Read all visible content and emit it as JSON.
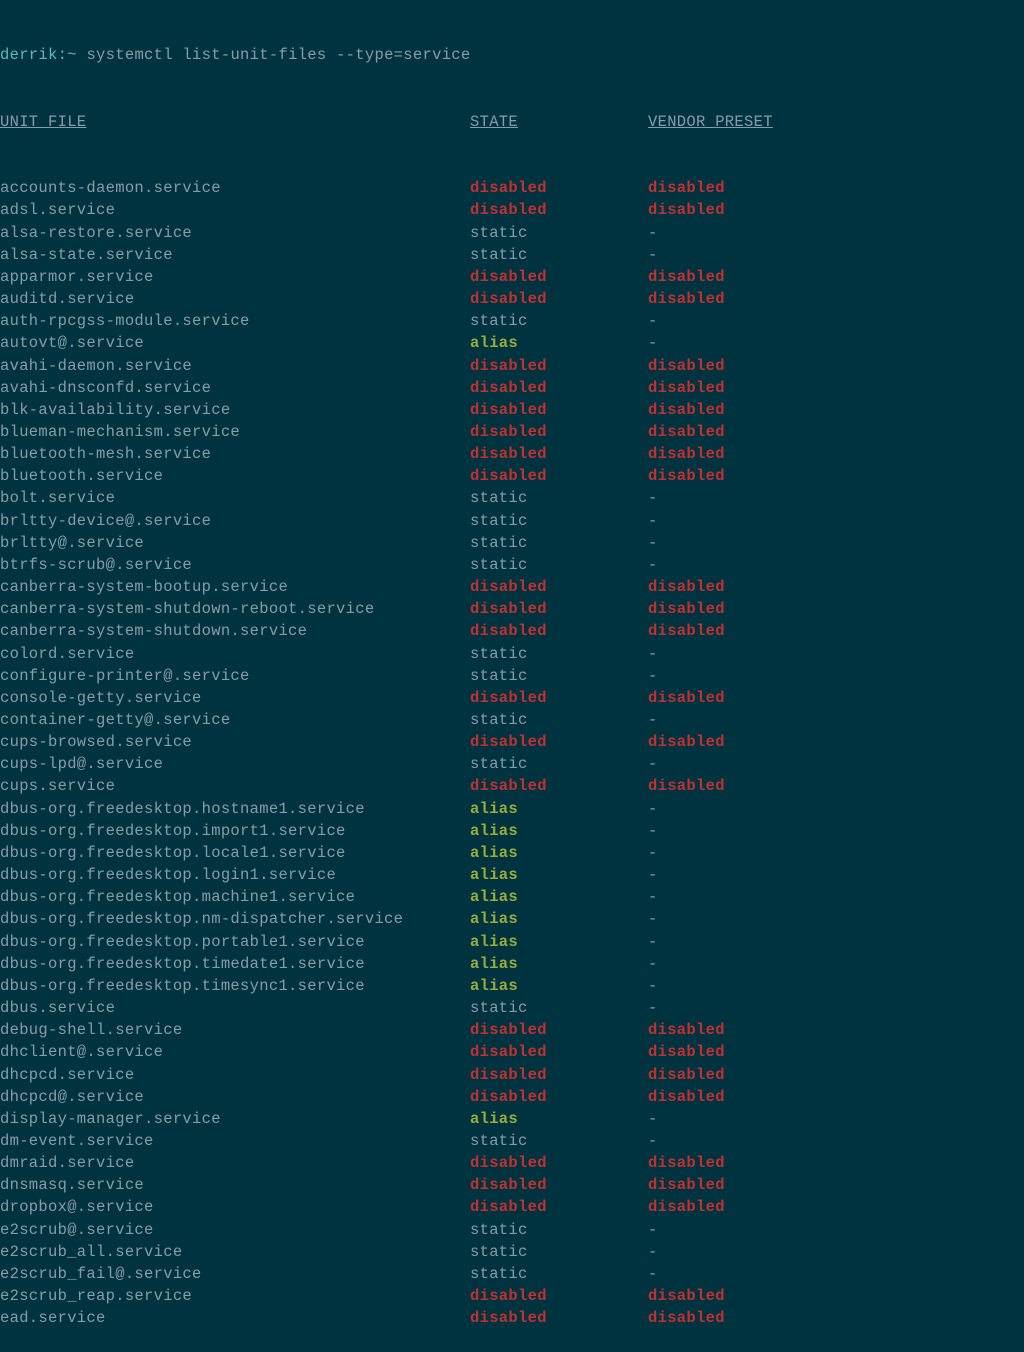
{
  "prompt": {
    "user": "derrik",
    "separator": ":",
    "path": "~",
    "command": "systemctl list-unit-files --type=service"
  },
  "headers": {
    "unit": "UNIT FILE",
    "state": "STATE",
    "preset": "VENDOR PRESET"
  },
  "rows": [
    {
      "unit": "accounts-daemon.service",
      "state": "disabled",
      "preset": "disabled"
    },
    {
      "unit": "adsl.service",
      "state": "disabled",
      "preset": "disabled"
    },
    {
      "unit": "alsa-restore.service",
      "state": "static",
      "preset": "-"
    },
    {
      "unit": "alsa-state.service",
      "state": "static",
      "preset": "-"
    },
    {
      "unit": "apparmor.service",
      "state": "disabled",
      "preset": "disabled"
    },
    {
      "unit": "auditd.service",
      "state": "disabled",
      "preset": "disabled"
    },
    {
      "unit": "auth-rpcgss-module.service",
      "state": "static",
      "preset": "-"
    },
    {
      "unit": "autovt@.service",
      "state": "alias",
      "preset": "-"
    },
    {
      "unit": "avahi-daemon.service",
      "state": "disabled",
      "preset": "disabled"
    },
    {
      "unit": "avahi-dnsconfd.service",
      "state": "disabled",
      "preset": "disabled"
    },
    {
      "unit": "blk-availability.service",
      "state": "disabled",
      "preset": "disabled"
    },
    {
      "unit": "blueman-mechanism.service",
      "state": "disabled",
      "preset": "disabled"
    },
    {
      "unit": "bluetooth-mesh.service",
      "state": "disabled",
      "preset": "disabled"
    },
    {
      "unit": "bluetooth.service",
      "state": "disabled",
      "preset": "disabled"
    },
    {
      "unit": "bolt.service",
      "state": "static",
      "preset": "-"
    },
    {
      "unit": "brltty-device@.service",
      "state": "static",
      "preset": "-"
    },
    {
      "unit": "brltty@.service",
      "state": "static",
      "preset": "-"
    },
    {
      "unit": "btrfs-scrub@.service",
      "state": "static",
      "preset": "-"
    },
    {
      "unit": "canberra-system-bootup.service",
      "state": "disabled",
      "preset": "disabled"
    },
    {
      "unit": "canberra-system-shutdown-reboot.service",
      "state": "disabled",
      "preset": "disabled"
    },
    {
      "unit": "canberra-system-shutdown.service",
      "state": "disabled",
      "preset": "disabled"
    },
    {
      "unit": "colord.service",
      "state": "static",
      "preset": "-"
    },
    {
      "unit": "configure-printer@.service",
      "state": "static",
      "preset": "-"
    },
    {
      "unit": "console-getty.service",
      "state": "disabled",
      "preset": "disabled"
    },
    {
      "unit": "container-getty@.service",
      "state": "static",
      "preset": "-"
    },
    {
      "unit": "cups-browsed.service",
      "state": "disabled",
      "preset": "disabled"
    },
    {
      "unit": "cups-lpd@.service",
      "state": "static",
      "preset": "-"
    },
    {
      "unit": "cups.service",
      "state": "disabled",
      "preset": "disabled"
    },
    {
      "unit": "dbus-org.freedesktop.hostname1.service",
      "state": "alias",
      "preset": "-"
    },
    {
      "unit": "dbus-org.freedesktop.import1.service",
      "state": "alias",
      "preset": "-"
    },
    {
      "unit": "dbus-org.freedesktop.locale1.service",
      "state": "alias",
      "preset": "-"
    },
    {
      "unit": "dbus-org.freedesktop.login1.service",
      "state": "alias",
      "preset": "-"
    },
    {
      "unit": "dbus-org.freedesktop.machine1.service",
      "state": "alias",
      "preset": "-"
    },
    {
      "unit": "dbus-org.freedesktop.nm-dispatcher.service",
      "state": "alias",
      "preset": "-"
    },
    {
      "unit": "dbus-org.freedesktop.portable1.service",
      "state": "alias",
      "preset": "-"
    },
    {
      "unit": "dbus-org.freedesktop.timedate1.service",
      "state": "alias",
      "preset": "-"
    },
    {
      "unit": "dbus-org.freedesktop.timesync1.service",
      "state": "alias",
      "preset": "-"
    },
    {
      "unit": "dbus.service",
      "state": "static",
      "preset": "-"
    },
    {
      "unit": "debug-shell.service",
      "state": "disabled",
      "preset": "disabled"
    },
    {
      "unit": "dhclient@.service",
      "state": "disabled",
      "preset": "disabled"
    },
    {
      "unit": "dhcpcd.service",
      "state": "disabled",
      "preset": "disabled"
    },
    {
      "unit": "dhcpcd@.service",
      "state": "disabled",
      "preset": "disabled"
    },
    {
      "unit": "display-manager.service",
      "state": "alias",
      "preset": "-"
    },
    {
      "unit": "dm-event.service",
      "state": "static",
      "preset": "-"
    },
    {
      "unit": "dmraid.service",
      "state": "disabled",
      "preset": "disabled"
    },
    {
      "unit": "dnsmasq.service",
      "state": "disabled",
      "preset": "disabled"
    },
    {
      "unit": "dropbox@.service",
      "state": "disabled",
      "preset": "disabled"
    },
    {
      "unit": "e2scrub@.service",
      "state": "static",
      "preset": "-"
    },
    {
      "unit": "e2scrub_all.service",
      "state": "static",
      "preset": "-"
    },
    {
      "unit": "e2scrub_fail@.service",
      "state": "static",
      "preset": "-"
    },
    {
      "unit": "e2scrub_reap.service",
      "state": "disabled",
      "preset": "disabled"
    },
    {
      "unit": "ead.service",
      "state": "disabled",
      "preset": "disabled"
    }
  ]
}
